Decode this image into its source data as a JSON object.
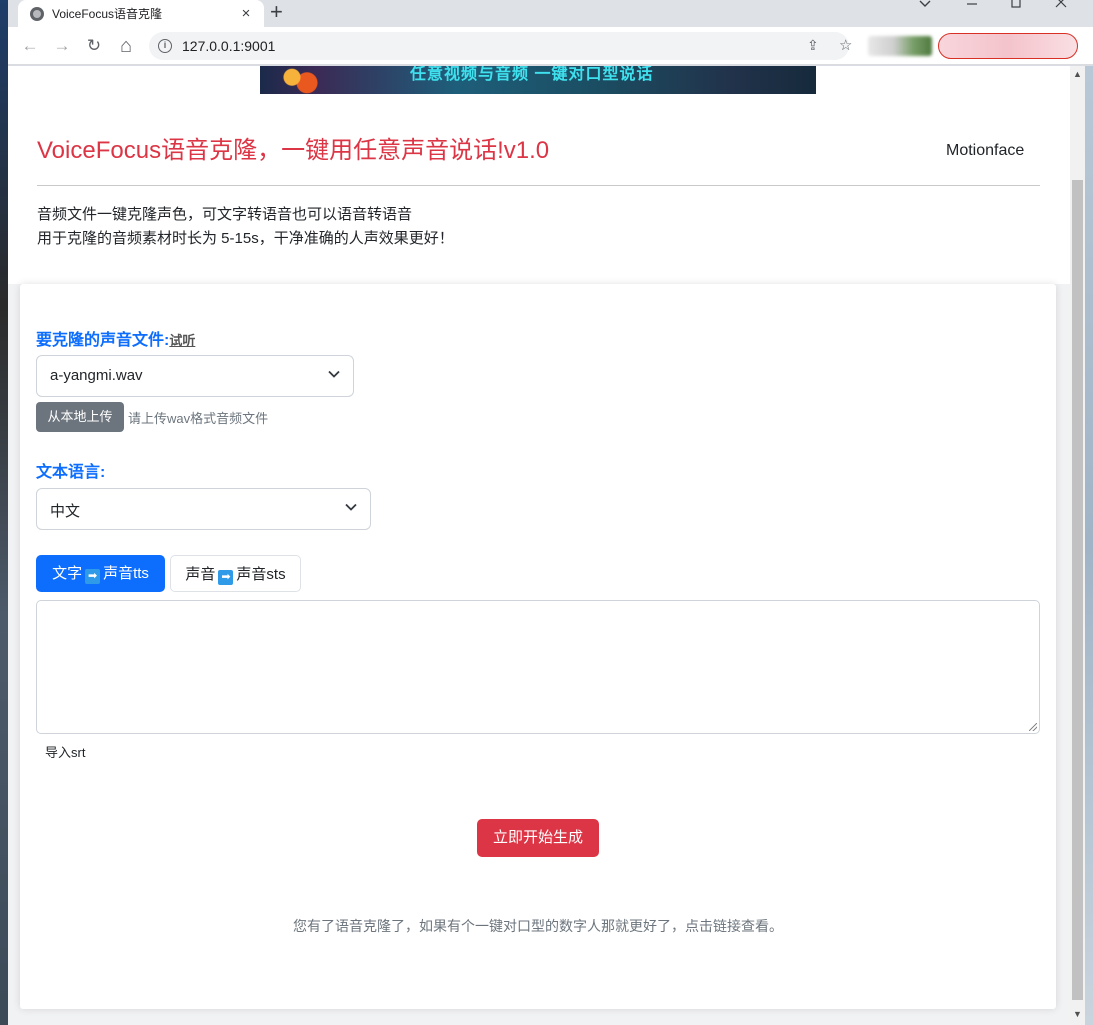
{
  "browser": {
    "tab_title": "VoiceFocus语音克隆",
    "tab_close": "×",
    "new_tab": "+",
    "url": "127.0.0.1:9001",
    "back_glyph": "←",
    "forward_glyph": "→",
    "reload_glyph": "↻",
    "home_glyph": "⌂",
    "share_glyph": "⇪",
    "star_glyph": "☆"
  },
  "banner": {
    "text": "任意视频与音频 一键对口型说话"
  },
  "header": {
    "title": "VoiceFocus语音克隆，一键用任意声音说话!v1.0",
    "nav_link": "Motionface",
    "desc_line1": "音频文件一键克隆声色，可文字转语音也可以语音转语音",
    "desc_line2": "用于克隆的音频素材时长为 5-15s，干净准确的人声效果更好！"
  },
  "form": {
    "voice_label": "要克隆的声音文件:",
    "listen_link": "试听",
    "voice_selected": "a-yangmi.wav",
    "upload_button": "从本地上传",
    "upload_hint": "请上传wav格式音频文件",
    "language_label": "文本语言:",
    "language_selected": "中文",
    "mode_tts_left": "文字",
    "mode_tts_right": "声音tts",
    "mode_sts_left": "声音",
    "mode_sts_right": "声音sts",
    "textarea_value": "",
    "import_srt": "导入srt",
    "generate_button": "立即开始生成",
    "footer_note": "您有了语音克隆了，如果有个一键对口型的数字人那就更好了，点击链接查看。"
  },
  "colors": {
    "primary": "#0d6efd",
    "danger": "#dc3545",
    "secondary": "#6c757d"
  },
  "icons": {
    "arrow_right": "➡"
  }
}
